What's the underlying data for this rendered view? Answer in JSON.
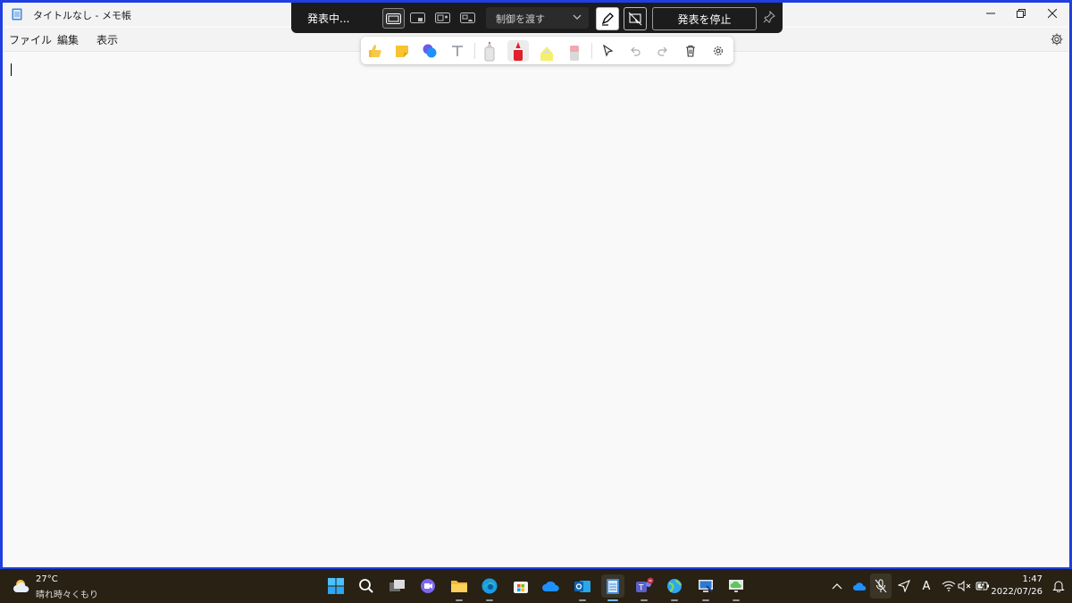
{
  "window": {
    "title": "タイトルなし - メモ帳",
    "menu": [
      "ファイル",
      "編集",
      "表示"
    ]
  },
  "presenter": {
    "status": "発表中...",
    "control_label": "制御を渡す",
    "stop_label": "発表を停止"
  },
  "ink_tools": [
    "reaction-thumbs-up",
    "sticky-note",
    "speech-bubbles",
    "text-tool",
    "pen-white",
    "pen-red",
    "highlighter-yellow",
    "eraser-pink",
    "pointer",
    "undo",
    "redo",
    "delete",
    "settings"
  ],
  "taskbar": {
    "weather_temp": "27°C",
    "weather_text": "晴れ時々くもり",
    "time": "1:47",
    "date": "2022/07/26",
    "apps": [
      "start",
      "search",
      "task-view",
      "chat",
      "file-explorer",
      "edge",
      "store",
      "onedrive",
      "outlook",
      "notepad",
      "teams",
      "browser",
      "remote-desktop",
      "cloud-app"
    ],
    "input_indicator": "A"
  },
  "colors": {
    "screen_border": "#1f3fe0",
    "taskbar_bg": "#282114",
    "presenter_bg": "#1c1c1c"
  }
}
